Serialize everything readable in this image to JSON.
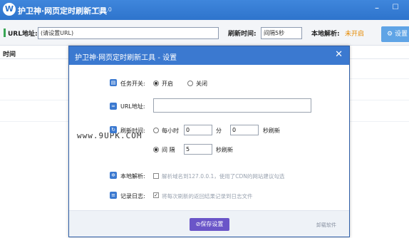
{
  "app": {
    "logo": "W",
    "title": "护卫神·网页定时刷新工具",
    "version": "V1.0.0"
  },
  "window_controls": {
    "minimize": "–",
    "maximize": "☐",
    "close": "✕"
  },
  "toolbar": {
    "url_label": "URL地址:",
    "url_placeholder": "(请设置URL)",
    "refresh_label": "刷新时间:",
    "refresh_value": "间隔5秒",
    "local_resolve_label": "本地解析:",
    "local_resolve_value": "未开启",
    "settings_label": "设置"
  },
  "list": {
    "col_time": "时间"
  },
  "dialog": {
    "title": "护卫神·网页定时刷新工具 - 设置",
    "close": "✕",
    "task_switch": {
      "label": "任务开关:",
      "on": "开启",
      "off": "关闭"
    },
    "url": {
      "label": "URL地址:",
      "value": ""
    },
    "refresh": {
      "label": "刷新时间:",
      "hourly_label": "每小时",
      "hourly_value": "0",
      "min_unit": "分",
      "sec_value": "0",
      "sec_unit": "秒刷新",
      "interval_label": "间  隔",
      "interval_value": "5",
      "interval_unit": "秒刷新"
    },
    "local_resolve": {
      "label": "本地解析:",
      "text": "解析域名到127.0.0.1，使用了CDN的网站建议勾选"
    },
    "log": {
      "label": "记录日志:",
      "text": "将每次刷新的返回结果记录到日志文件"
    },
    "save": "保存设置",
    "uninstall": "卸载软件"
  },
  "watermark": "www.9UPK.COM",
  "colors": {
    "titlebar": "#3b79d0",
    "save_button": "#6a55c8",
    "status_off": "#e68a00",
    "accent_green": "#3aa655"
  }
}
